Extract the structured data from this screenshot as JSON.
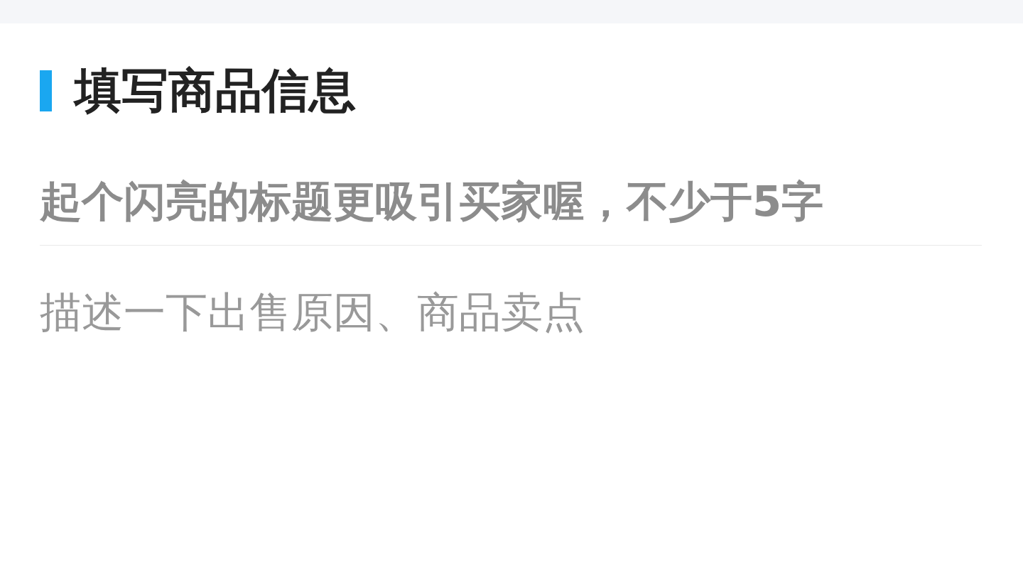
{
  "section": {
    "title": "填写商品信息"
  },
  "title_field": {
    "placeholder": "起个闪亮的标题更吸引买家喔，不少于5字"
  },
  "description_field": {
    "placeholder": "描述一下出售原因、商品卖点"
  }
}
